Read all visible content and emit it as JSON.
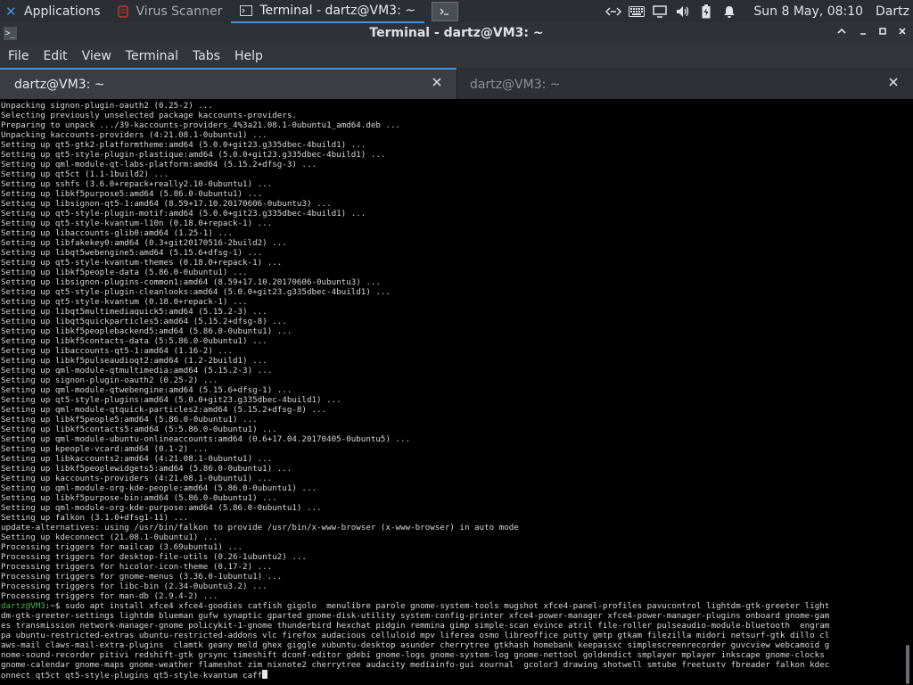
{
  "panel": {
    "applications_label": "Applications",
    "tasks": [
      {
        "label": "Virus Scanner",
        "active": false
      },
      {
        "label": "Terminal - dartz@VM3: ~",
        "active": true
      }
    ],
    "clock": "Sun  8 May, 08:10",
    "user": "Dartz",
    "tray_icons": [
      "network-icon",
      "keyboard-icon",
      "display-icon",
      "volume-icon",
      "battery-icon",
      "notification-bell-icon"
    ],
    "accent": "#4a90e2"
  },
  "window": {
    "title": "Terminal - dartz@VM3: ~",
    "menu": [
      "File",
      "Edit",
      "View",
      "Terminal",
      "Tabs",
      "Help"
    ],
    "tabs": [
      {
        "label": "dartz@VM3: ~",
        "active": true
      },
      {
        "label": "dartz@VM3: ~",
        "active": false
      }
    ]
  },
  "terminal": {
    "output_lines": [
      "Unpacking signon-plugin-oauth2 (0.25-2) ...",
      "Selecting previously unselected package kaccounts-providers.",
      "Preparing to unpack .../39-kaccounts-providers_4%3a21.08.1-0ubuntu1_amd64.deb ...",
      "Unpacking kaccounts-providers (4:21.08.1-0ubuntu1) ...",
      "Setting up qt5-gtk2-platformtheme:amd64 (5.0.0+git23.g335dbec-4build1) ...",
      "Setting up qt5-style-plugin-plastique:amd64 (5.0.0+git23.g335dbec-4build1) ...",
      "Setting up qml-module-qt-labs-platform:amd64 (5.15.2+dfsg-3) ...",
      "Setting up qt5ct (1.1-1build2) ...",
      "Setting up sshfs (3.6.0+repack+really2.10-0ubuntu1) ...",
      "Setting up libkf5purpose5:amd64 (5.86.0-0ubuntu1) ...",
      "Setting up libsignon-qt5-1:amd64 (8.59+17.10.20170606-0ubuntu3) ...",
      "Setting up qt5-style-plugin-motif:amd64 (5.0.0+git23.g335dbec-4build1) ...",
      "Setting up qt5-style-kvantum-l10n (0.18.0+repack-1) ...",
      "Setting up libaccounts-glib0:amd64 (1.25-1) ...",
      "Setting up libfakekey0:amd64 (0.3+git20170516-2build2) ...",
      "Setting up libqt5webengine5:amd64 (5.15.6+dfsg-1) ...",
      "Setting up qt5-style-kvantum-themes (0.18.0+repack-1) ...",
      "Setting up libkf5people-data (5.86.0-0ubuntu1) ...",
      "Setting up libsignon-plugins-common1:amd64 (8.59+17.10.20170606-0ubuntu3) ...",
      "Setting up qt5-style-plugin-cleanlooks:amd64 (5.0.0+git23.g335dbec-4build1) ...",
      "Setting up qt5-style-kvantum (0.18.0+repack-1) ...",
      "Setting up libqt5multimediaquick5:amd64 (5.15.2-3) ...",
      "Setting up libqt5quickparticles5:amd64 (5.15.2+dfsg-8) ...",
      "Setting up libkf5peoplebackend5:amd64 (5.86.0-0ubuntu1) ...",
      "Setting up libkf5contacts-data (5:5.86.0-0ubuntu1) ...",
      "Setting up libaccounts-qt5-1:amd64 (1.16-2) ...",
      "Setting up libkf5pulseaudioqt2:amd64 (1.2-2build1) ...",
      "Setting up qml-module-qtmultimedia:amd64 (5.15.2-3) ...",
      "Setting up signon-plugin-oauth2 (0.25-2) ...",
      "Setting up qml-module-qtwebengine:amd64 (5.15.6+dfsg-1) ...",
      "Setting up qt5-style-plugins:amd64 (5.0.0+git23.g335dbec-4build1) ...",
      "Setting up qml-module-qtquick-particles2:amd64 (5.15.2+dfsg-8) ...",
      "Setting up libkf5people5:amd64 (5.86.0-0ubuntu1) ...",
      "Setting up libkf5contacts5:amd64 (5:5.86.0-0ubuntu1) ...",
      "Setting up qml-module-ubuntu-onlineaccounts:amd64 (0.6+17.04.20170405-0ubuntu5) ...",
      "Setting up kpeople-vcard:amd64 (0.1-2) ...",
      "Setting up libkaccounts2:amd64 (4:21.08.1-0ubuntu1) ...",
      "Setting up libkf5peoplewidgets5:amd64 (5.86.0-0ubuntu1) ...",
      "Setting up kaccounts-providers (4:21.08.1-0ubuntu1) ...",
      "Setting up qml-module-org-kde-people:amd64 (5.86.0-0ubuntu1) ...",
      "Setting up libkf5purpose-bin:amd64 (5.86.0-0ubuntu1) ...",
      "Setting up qml-module-org-kde-purpose:amd64 (5.86.0-0ubuntu1) ...",
      "Setting up falkon (3.1.0+dfsg1-11) ...",
      "update-alternatives: using /usr/bin/falkon to provide /usr/bin/x-www-browser (x-www-browser) in auto mode",
      "Setting up kdeconnect (21.08.1-0ubuntu1) ...",
      "Processing triggers for mailcap (3.69ubuntu1) ...",
      "Processing triggers for desktop-file-utils (0.26-1ubuntu2) ...",
      "Processing triggers for hicolor-icon-theme (0.17-2) ...",
      "Processing triggers for gnome-menus (3.36.0-1ubuntu1) ...",
      "Processing triggers for libc-bin (2.34-0ubuntu3.2) ...",
      "Processing triggers for man-db (2.9.4-2) ..."
    ],
    "prompt": "dartz@VM3",
    "prompt_suffix": ":~$ ",
    "command_lines": [
      "sudo apt install xfce4 xfce4-goodies catfish gigolo  menulibre parole gnome-system-tools mugshot xfce4-panel-profiles pavucontrol lightdm-gtk-greeter light",
      "dm-gtk-greeter-settings lightdm blueman gufw synaptic gparted gnome-disk-utility system-config-printer xfce4-power-manager xfce4-power-manager-plugins onboard gnome-gam",
      "es transmission network-manager-gnome policykit-1-gnome thunderbird hexchat pidgin remmina gimp simple-scan evince atril file-roller pulseaudio-module-bluetooth  engram",
      "pa ubuntu-restricted-extras ubuntu-restricted-addons vlc firefox audacious celluloid mpv liferea osmo libreoffice putty gmtp gtkam filezilla midori netsurf-gtk dillo cl",
      "aws-mail claws-mail-extra-plugins  clamtk geany meld ghex giggle xubuntu-desktop asunder cherrytree gtkhash homebank keepassxc simplescreenrecorder guvcview webcamoid g",
      "nome-sound-recorder pitivi redshift-gtk grsync timeshift dconf-editor gdebi gnome-logs gnome-system-log gnome-nettool goldendict smplayer mplayer inkscape gnome-clocks",
      "gnome-calendar gnome-maps gnome-weather flameshot zim nixnote2 cherrytree audacity mediainfo-gui xournal  gcolor3 drawing shotwell smtube freetuxtv fbreader falkon kdec",
      "onnect qt5ct qt5-style-plugins qt5-style-kvantum caff"
    ],
    "colors": {
      "background": "#000000",
      "text": "#d8d8d8",
      "prompt": "#43b84c"
    }
  }
}
